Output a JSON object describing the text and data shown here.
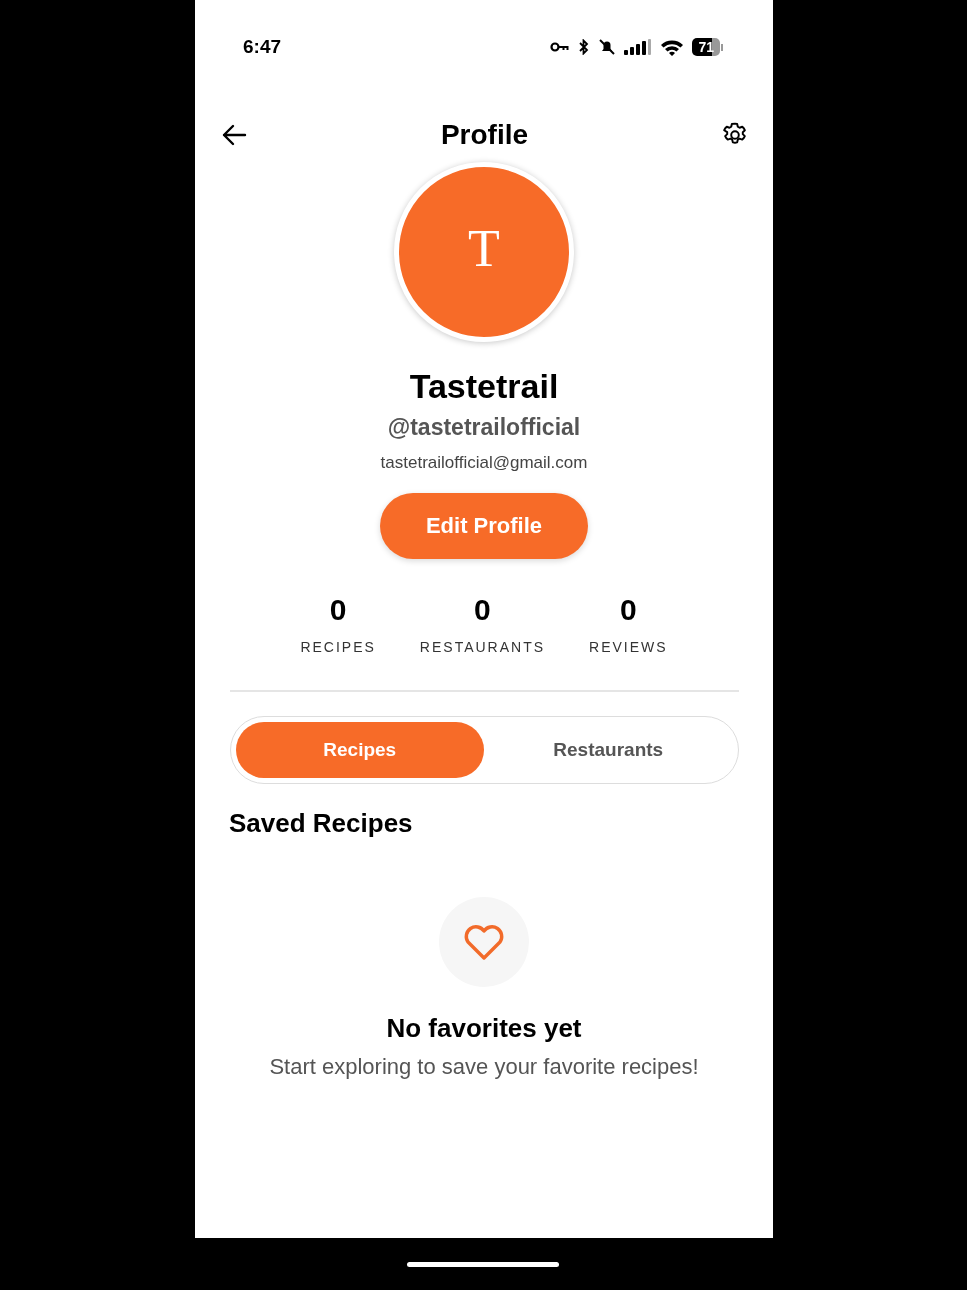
{
  "status_bar": {
    "time": "6:47",
    "battery": "71"
  },
  "header": {
    "title": "Profile"
  },
  "profile": {
    "initial": "T",
    "name": "Tastetrail",
    "handle": "@tastetrailofficial",
    "email": "tastetrailofficial@gmail.com"
  },
  "edit_button": "Edit Profile",
  "stats": [
    {
      "value": "0",
      "label": "RECIPES"
    },
    {
      "value": "0",
      "label": "RESTAURANTS"
    },
    {
      "value": "0",
      "label": "REVIEWS"
    }
  ],
  "tabs": [
    {
      "label": "Recipes",
      "selected": true
    },
    {
      "label": "Restaurants",
      "selected": false
    }
  ],
  "section_title": "Saved Recipes",
  "empty_state": {
    "title": "No favorites yet",
    "message": "Start exploring to save your favorite recipes!"
  }
}
